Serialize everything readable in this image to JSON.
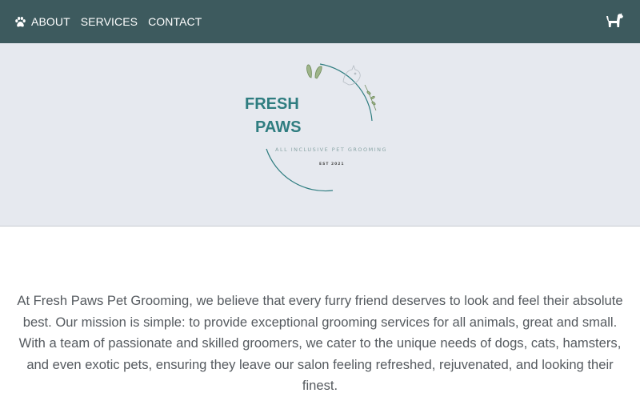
{
  "nav": {
    "links": [
      {
        "label": "ABOUT"
      },
      {
        "label": "SERVICES"
      },
      {
        "label": "CONTACT"
      }
    ],
    "left_icon": "paw-icon",
    "right_icon": "dog-icon",
    "background": "#3d5a5e"
  },
  "hero": {
    "logo": {
      "line1": "FRESH",
      "line2": "PAWS",
      "tagline": "ALL INCLUSIVE PET GROOMING",
      "est": "EST 2021"
    },
    "background": "#e6e9ef",
    "accent": "#2f7d80"
  },
  "about": {
    "mission": "At Fresh Paws Pet Grooming, we believe that every furry friend deserves to look and feel their absolute best. Our mission is simple: to provide exceptional grooming services for all animals, great and small. With a team of passionate and skilled groomers, we cater to the unique needs of dogs, cats, hamsters, and even exotic pets, ensuring they leave our salon feeling refreshed, rejuvenated, and looking their finest."
  }
}
